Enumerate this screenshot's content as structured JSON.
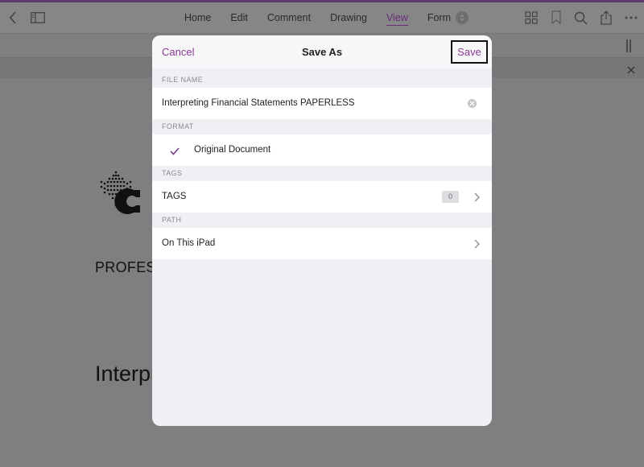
{
  "menu": {
    "items": [
      "Home",
      "Edit",
      "Comment",
      "Drawing",
      "View",
      "Form"
    ],
    "active": "View"
  },
  "document": {
    "line1": "PROFES",
    "line2": "Interpr"
  },
  "dialog": {
    "title": "Save As",
    "cancel_label": "Cancel",
    "save_label": "Save",
    "file_name_header": "FILE NAME",
    "file_name_value": "Interpreting Financial Statements PAPERLESS",
    "format_header": "FORMAT",
    "format_value": "Original Document",
    "tags_header": "TAGS",
    "tags_label": "TAGS",
    "tags_count": "0",
    "path_header": "PATH",
    "path_value": "On This iPad"
  },
  "colors": {
    "accent": "#8a3a93",
    "check": "#7c3a8a"
  },
  "icons": [
    "back-icon",
    "sidebar-icon",
    "form-toggle-icon",
    "grid-icon",
    "bookmark-icon",
    "search-icon",
    "share-icon",
    "more-icon",
    "pencil-icon",
    "close-icon",
    "clear-icon",
    "checkmark-icon",
    "chevron-right-icon"
  ]
}
